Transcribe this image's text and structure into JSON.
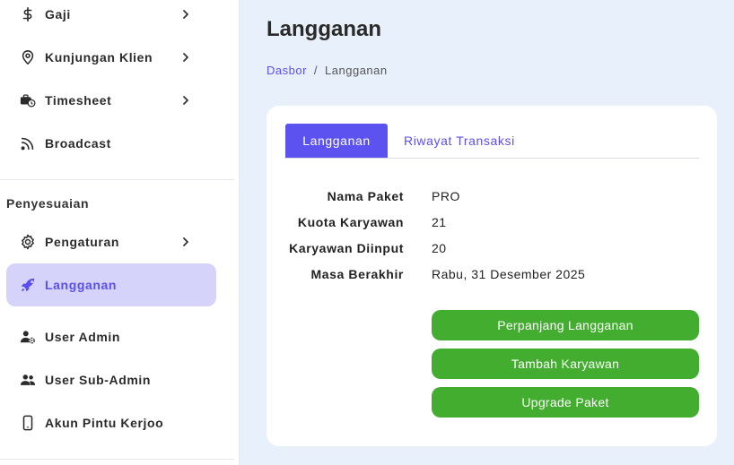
{
  "sidebar": {
    "items": [
      {
        "label": "Gaji",
        "icon": "dollar-icon"
      },
      {
        "label": "Kunjungan Klien",
        "icon": "map-pin-icon"
      },
      {
        "label": "Timesheet",
        "icon": "briefcase-clock-icon"
      },
      {
        "label": "Broadcast",
        "icon": "rss-icon"
      }
    ],
    "section_title": "Penyesuaian",
    "settings_items": [
      {
        "label": "Pengaturan",
        "icon": "gear-icon"
      },
      {
        "label": "Langganan",
        "icon": "rocket-icon"
      },
      {
        "label": "User Admin",
        "icon": "user-gear-icon"
      },
      {
        "label": "User Sub-Admin",
        "icon": "users-icon"
      },
      {
        "label": "Akun Pintu Kerjoo",
        "icon": "mobile-icon"
      }
    ]
  },
  "page": {
    "title": "Langganan",
    "breadcrumb": {
      "home": "Dasbor",
      "separator": "/",
      "current": "Langganan"
    }
  },
  "card": {
    "tabs": [
      {
        "label": "Langganan",
        "active": true
      },
      {
        "label": "Riwayat Transaksi",
        "active": false
      }
    ],
    "info": [
      {
        "label": "Nama Paket",
        "value": "PRO"
      },
      {
        "label": "Kuota Karyawan",
        "value": "21"
      },
      {
        "label": "Karyawan Diinput",
        "value": "20"
      },
      {
        "label": "Masa Berakhir",
        "value": "Rabu, 31 Desember 2025"
      }
    ],
    "buttons": {
      "extend": "Perpanjang Langganan",
      "add_employee": "Tambah Karyawan",
      "upgrade": "Upgrade Paket"
    }
  },
  "colors": {
    "accent": "#5b52f0",
    "active_bg": "#d6d3fb",
    "button_green": "#42ad2f",
    "page_bg": "#e8f0fb"
  }
}
